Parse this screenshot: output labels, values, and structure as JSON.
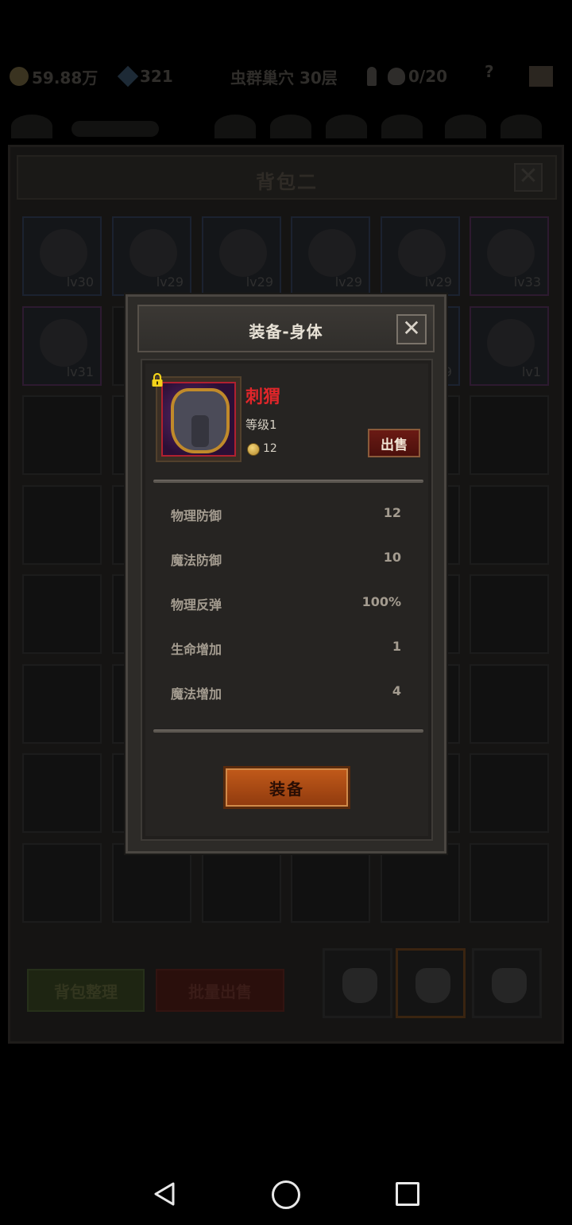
{
  "hud": {
    "gold": "59.88万",
    "gems": "321",
    "location": "虫群巢穴 30层",
    "keys": "0/20",
    "help": "?"
  },
  "bag": {
    "title": "背包二",
    "close_label": "✕",
    "row1": [
      {
        "level": "lv30"
      },
      {
        "level": "lv29"
      },
      {
        "level": "lv29"
      },
      {
        "level": "lv29"
      },
      {
        "level": "lv29"
      },
      {
        "level": "lv33"
      }
    ],
    "row2": [
      {
        "level": "lv31"
      },
      {
        "level": ""
      },
      {
        "level": ""
      },
      {
        "level": ""
      },
      {
        "level": "9"
      },
      {
        "level": "lv1"
      }
    ],
    "sort_label": "背包整理",
    "batch_sell_label": "批量出售"
  },
  "modal": {
    "title": "装备-身体",
    "close_label": "✕",
    "item": {
      "name": "刺猬",
      "level_text": "等级1",
      "price": "12",
      "sell_label": "出售"
    },
    "stats": [
      {
        "label": "物理防御",
        "value": "12"
      },
      {
        "label": "魔法防御",
        "value": "10"
      },
      {
        "label": "物理反弹",
        "value": "100%"
      },
      {
        "label": "生命增加",
        "value": "1"
      },
      {
        "label": "魔法增加",
        "value": "4"
      }
    ],
    "equip_label": "装备"
  },
  "colors": {
    "item_name": "#e0262a",
    "equip_button": "#c25a1a",
    "sell_button": "#6a1a14",
    "rarity_frame": "#b02030"
  }
}
